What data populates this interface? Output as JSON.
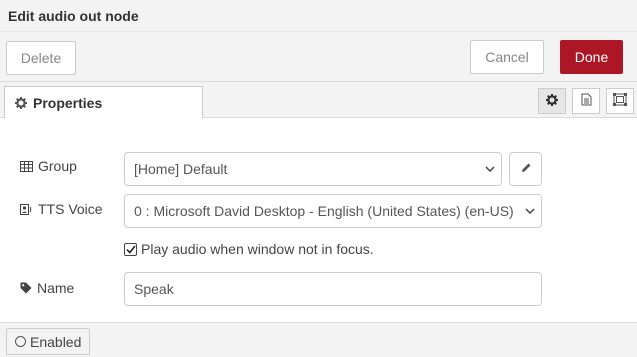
{
  "dialog": {
    "title": "Edit audio out node"
  },
  "toolbar": {
    "delete_label": "Delete",
    "cancel_label": "Cancel",
    "done_label": "Done"
  },
  "tabs": {
    "properties_label": "Properties"
  },
  "form": {
    "group_label": "Group",
    "group_value": "[Home] Default",
    "tts_label": "TTS Voice",
    "tts_value": "0 : Microsoft David Desktop - English (United States) (en-US)",
    "checkbox_label": "Play audio when window not in focus.",
    "checkbox_checked": true,
    "name_label": "Name",
    "name_value": "Speak"
  },
  "footer": {
    "enabled_label": "Enabled"
  },
  "colors": {
    "done_bg": "#ad1625",
    "panel_bg": "#f3f3f3",
    "border": "#cccccc"
  },
  "icons": [
    "gear-icon",
    "document-icon",
    "frame-icon",
    "table-icon",
    "voice-icon",
    "pencil-icon",
    "tag-icon",
    "chevron-down-icon",
    "checkmark-icon",
    "circle-icon"
  ]
}
